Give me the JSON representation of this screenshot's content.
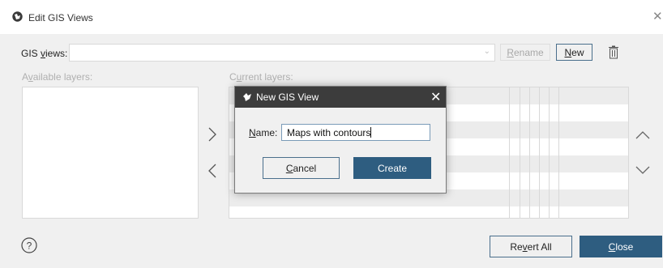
{
  "window": {
    "title": "Edit GIS Views",
    "close_glyph": "✕"
  },
  "gis_views": {
    "label_pre": "GIS ",
    "label_u": "v",
    "label_post": "iews:",
    "value": ""
  },
  "buttons": {
    "rename": {
      "pre": "",
      "u": "R",
      "post": "ename"
    },
    "new": {
      "pre": "",
      "u": "N",
      "post": "ew"
    },
    "revert_all": {
      "pre": "Re",
      "u": "v",
      "post": "ert All"
    },
    "close": {
      "pre": "",
      "u": "C",
      "post": "lose"
    }
  },
  "available_layers": {
    "pre": "A",
    "u": "v",
    "post": "ailable layers:"
  },
  "current_layers": {
    "pre": "C",
    "u": "u",
    "post": "rrent layers:"
  },
  "icons": {
    "app": "app-icon",
    "trash": "trash-icon",
    "move_right": "chevron-right-icon",
    "move_left": "chevron-left-icon",
    "move_up": "chevron-up-icon",
    "move_down": "chevron-down-icon",
    "help": "help-icon"
  },
  "dialog": {
    "title": "New GIS View",
    "close_glyph": "✕",
    "name_label": {
      "pre": "",
      "u": "N",
      "post": "ame:"
    },
    "name_value": "Maps with contours",
    "cancel": {
      "pre": "",
      "u": "C",
      "post": "ancel"
    },
    "create": "Create"
  },
  "colors": {
    "primary": "#2e5d80",
    "dialog_title_bg": "#3c3c3c"
  }
}
